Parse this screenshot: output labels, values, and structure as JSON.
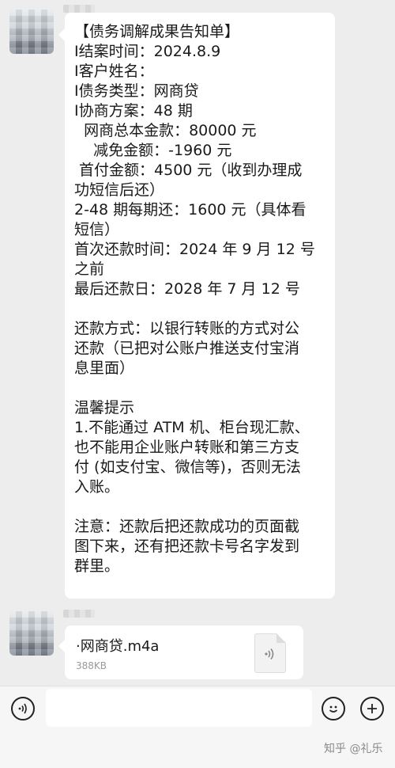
{
  "message": {
    "lines": [
      "【债务调解成果告知单】",
      "I结案时间：2024.8.9",
      "I客户姓名：",
      "I债务类型：网商贷",
      "I协商方案：48 期",
      "  网商总本金款：80000 元",
      "    减免金额：-1960 元",
      " 首付金额：4500 元（收到办理成",
      "功短信后还）",
      "2-48 期每期还：1600 元（具体看",
      "短信）",
      "首次还款时间：2024 年 9 月 12 号",
      "之前",
      "最后还款日：2028 年 7 月 12 号",
      "",
      "还款方式：以银行转账的方式对公",
      "还款（已把对公账户推送支付宝消",
      "息里面）",
      "",
      "温馨提示",
      "1.不能通过 ATM 机、柜台现汇款、",
      "也不能用企业账户转账和第三方支",
      "付 (如支付宝、微信等)，否则无法",
      "入账。",
      "",
      "注意：还款后把还款成功的页面截",
      "图下来，还有把还款卡号名字发到",
      "群里。"
    ]
  },
  "file_message": {
    "name": "·网商贷.m4a",
    "size": "388KB",
    "icon": "audio-file-icon"
  },
  "input_bar": {
    "left_icon": "voice-icon",
    "emoji_icon": "emoji-icon",
    "plus_icon": "plus-icon"
  },
  "watermark": "知乎 @礼乐"
}
